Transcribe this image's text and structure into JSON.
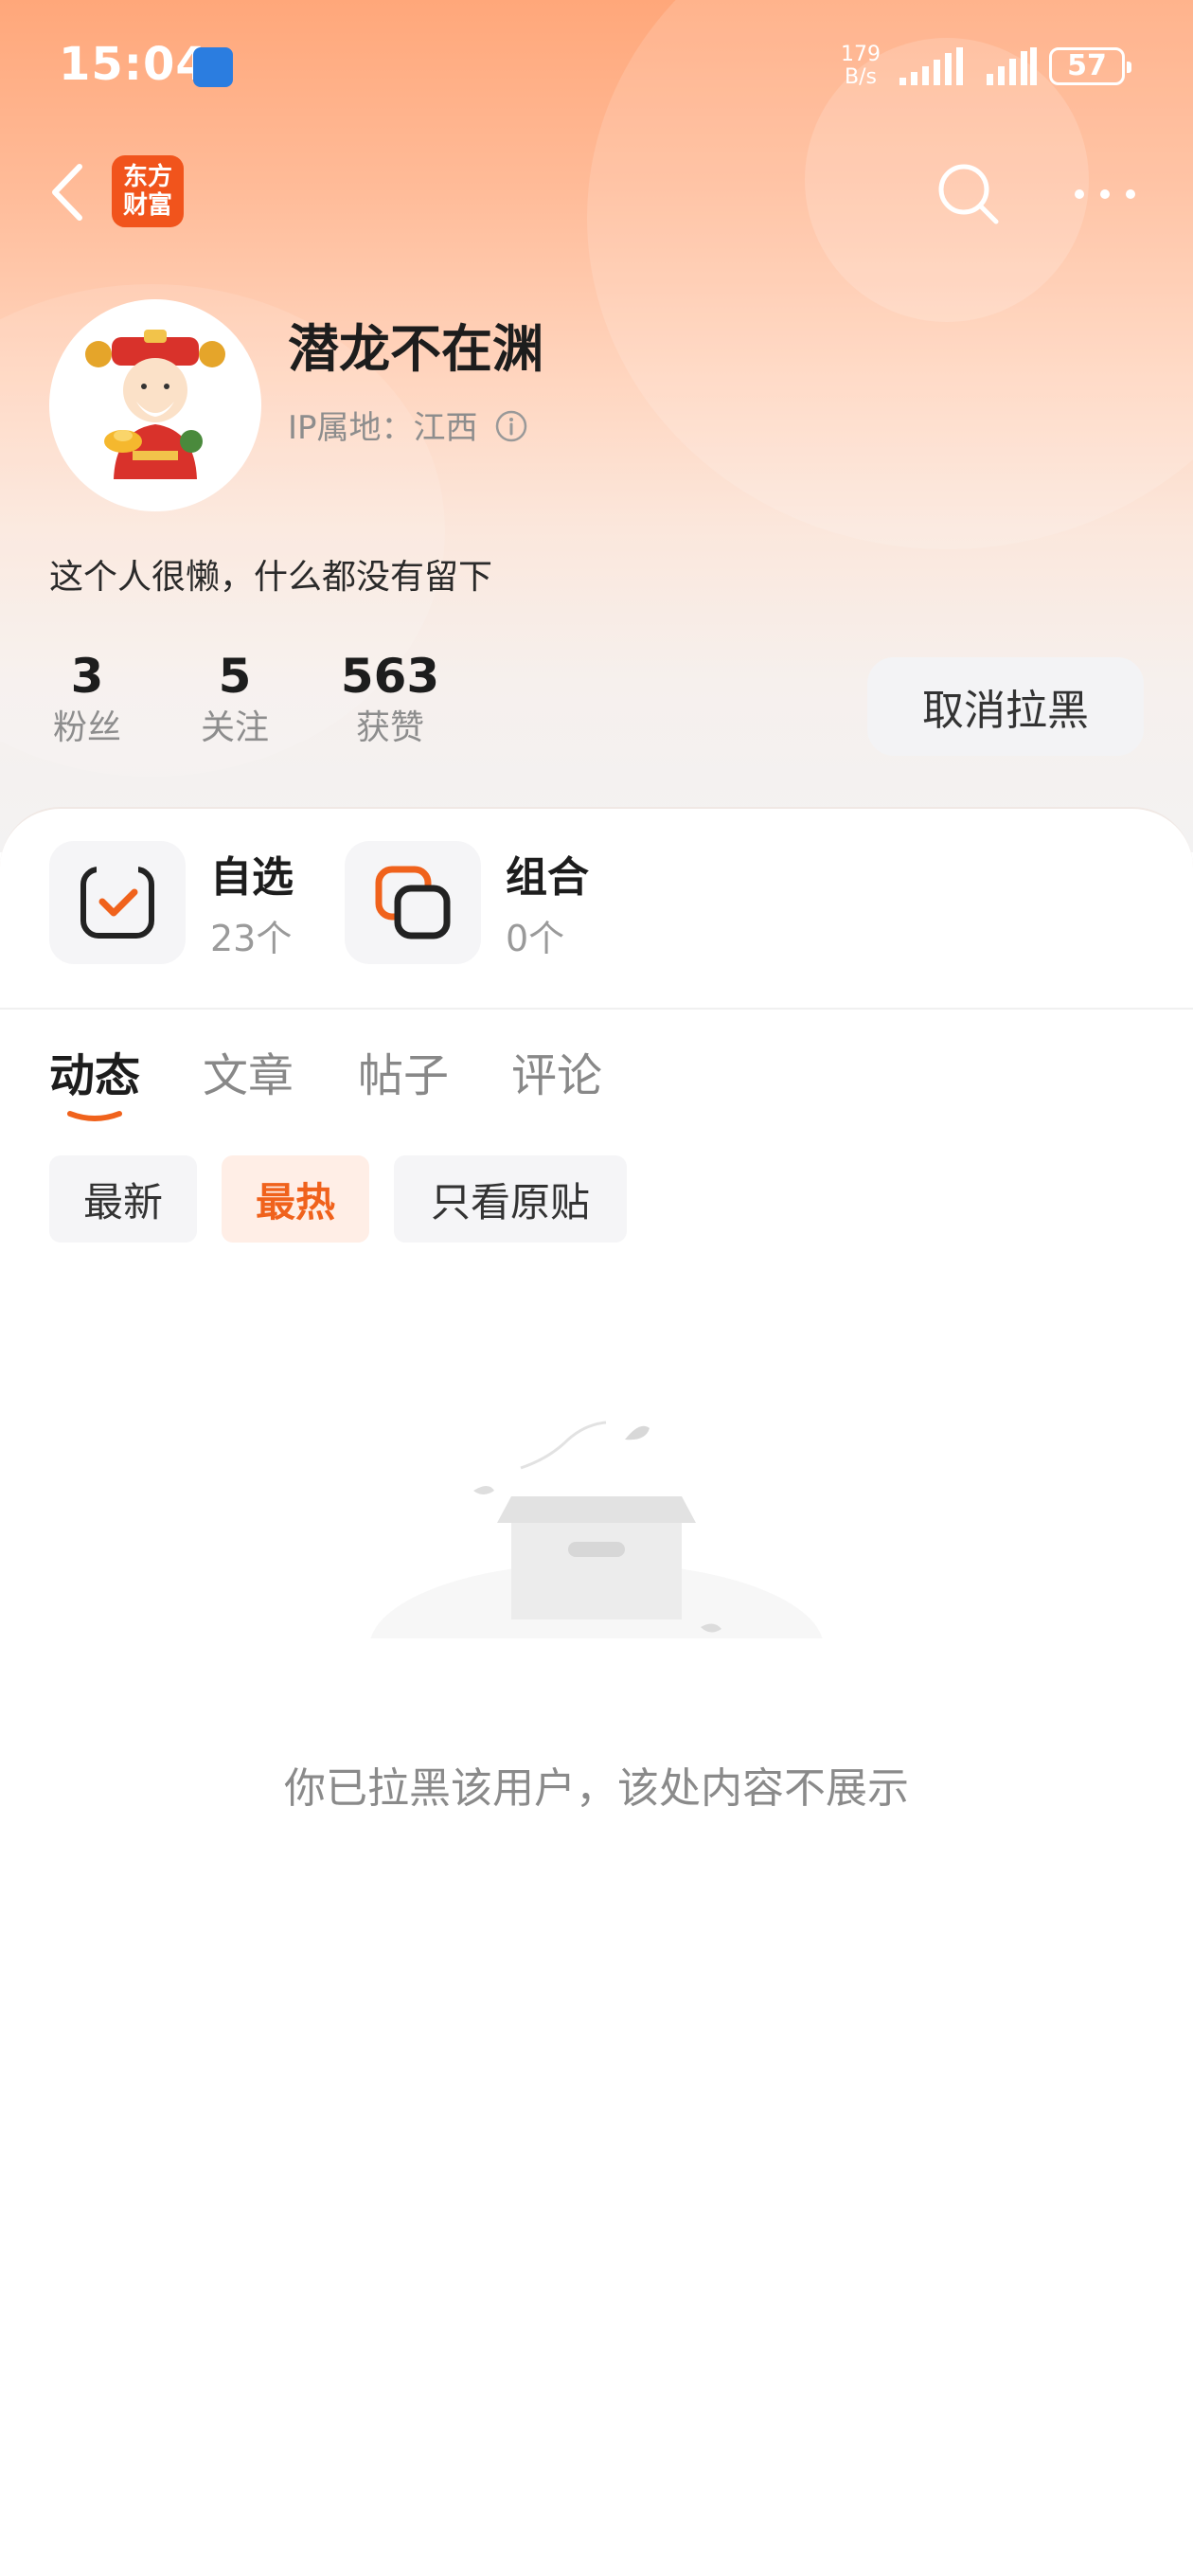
{
  "status_bar": {
    "time": "15:04",
    "speed_value": "179",
    "speed_unit": "B/s",
    "battery": "57"
  },
  "nav": {
    "brand_line1": "东方",
    "brand_line2": "财富"
  },
  "profile": {
    "name": "潜龙不在渊",
    "ip_location": "IP属地：江西",
    "bio": "这个人很懒，什么都没有留下",
    "stats": [
      {
        "value": "3",
        "label": "粉丝"
      },
      {
        "value": "5",
        "label": "关注"
      },
      {
        "value": "563",
        "label": "获赞"
      }
    ],
    "unblock_label": "取消拉黑"
  },
  "quick_cards": [
    {
      "title": "自选",
      "subtitle": "23个",
      "icon": "watchlist-check-icon"
    },
    {
      "title": "组合",
      "subtitle": "0个",
      "icon": "portfolio-combo-icon"
    }
  ],
  "tabs": [
    "动态",
    "文章",
    "帖子",
    "评论"
  ],
  "active_tab": "动态",
  "filters": [
    "最新",
    "最热",
    "只看原贴"
  ],
  "active_filter": "最热",
  "empty_message": "你已拉黑该用户，该处内容不展示",
  "colors": {
    "accent": "#f0621c",
    "hero_top": "#ffa77a",
    "muted_text": "#8a8a8a"
  }
}
